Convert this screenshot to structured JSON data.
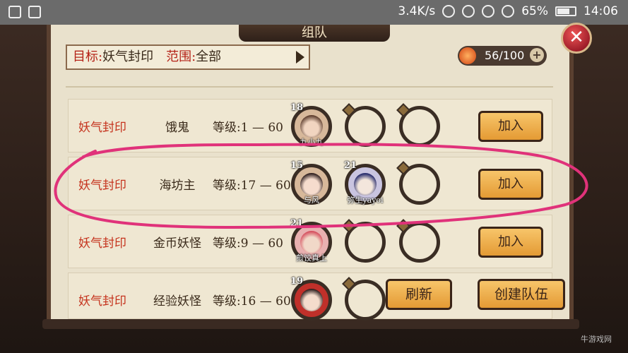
{
  "status_bar": {
    "speed": "3.4K/s",
    "battery": "65%",
    "time": "14:06"
  },
  "window": {
    "title": "组队",
    "close_label": "✕"
  },
  "filter": {
    "target_key": "目标:",
    "target_value": "妖气封印",
    "range_key": "范围:",
    "range_value": "全部"
  },
  "stamina": {
    "value": "56/100",
    "plus": "+"
  },
  "rows": [
    {
      "type": "妖气封印",
      "target": "饿鬼",
      "level": "等级:1 — 60",
      "members": [
        {
          "lv": "18",
          "name": "九小九"
        }
      ],
      "join_label": "加入"
    },
    {
      "type": "妖气封印",
      "target": "海坊主",
      "level": "等级:17 — 60",
      "members": [
        {
          "lv": "15",
          "name": "与风"
        },
        {
          "lv": "21",
          "name": "弥生yayoi"
        }
      ],
      "join_label": "加入"
    },
    {
      "type": "妖气封印",
      "target": "金币妖怪",
      "level": "等级:9 — 60",
      "members": [
        {
          "lv": "21",
          "name": "煎饺真上"
        }
      ],
      "join_label": "加入"
    },
    {
      "type": "妖气封印",
      "target": "经验妖怪",
      "level": "等级:16 — 60",
      "members": [
        {
          "lv": "19",
          "name": ""
        }
      ]
    }
  ],
  "buttons": {
    "refresh": "刷新",
    "create_team": "创建队伍"
  },
  "colors": {
    "accent_red": "#c5331d",
    "button_orange": "#f0b04e",
    "annotation_pink": "#e0327a"
  },
  "watermark": "牛游戏网"
}
